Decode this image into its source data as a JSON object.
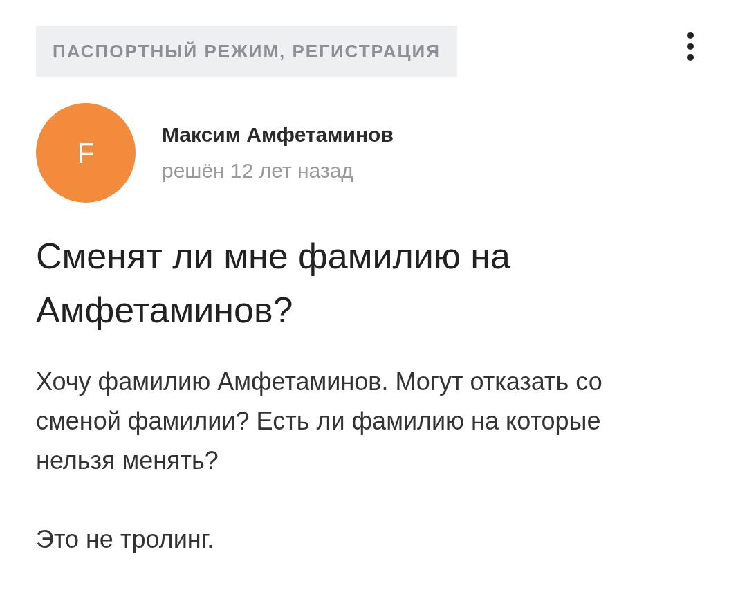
{
  "category": {
    "label": "ПАСПОРТНЫЙ РЕЖИМ, РЕГИСТРАЦИЯ"
  },
  "author": {
    "avatar_letter": "F",
    "name": "Максим Амфетаминов",
    "meta": "решён 12 лет назад"
  },
  "question": {
    "title": "Сменят ли мне фамилию на Амфетаминов?",
    "paragraphs": [
      "Хочу фамилию Амфетаминов. Могут отказать со сменой фамилии? Есть ли фамилию на которые нельзя менять?",
      "Это не тролинг."
    ]
  }
}
